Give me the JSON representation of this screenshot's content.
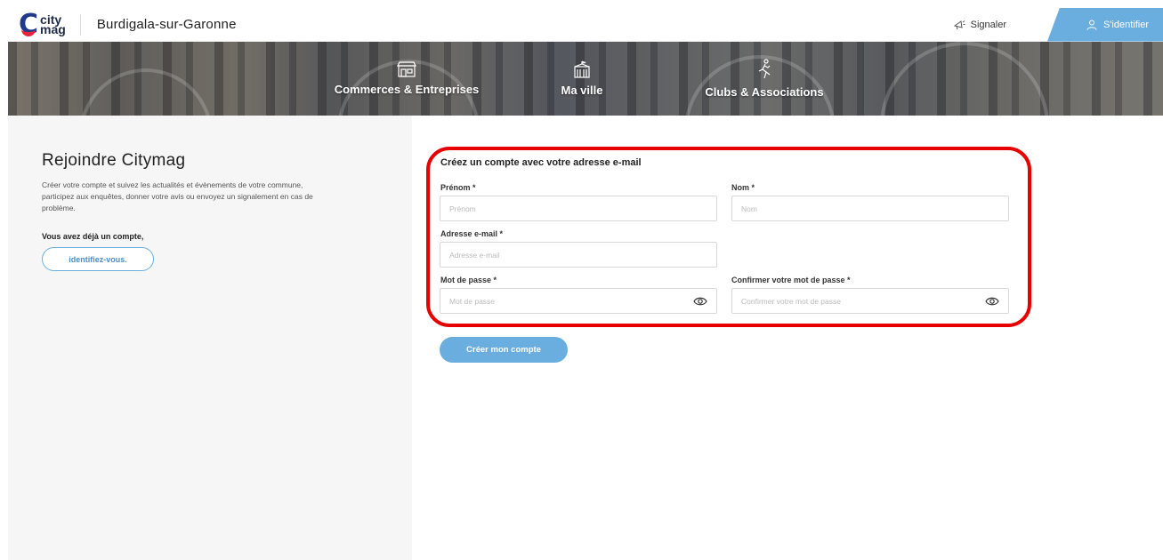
{
  "header": {
    "logo_top": "city",
    "logo_bottom": "mag",
    "city_name": "Burdigala-sur-Garonne",
    "report_label": "Signaler",
    "login_label": "S'identifier"
  },
  "nav": {
    "items": [
      {
        "label": "Commerces & Entreprises",
        "icon": "shop-icon"
      },
      {
        "label": "Ma ville",
        "icon": "town-hall-icon"
      },
      {
        "label": "Clubs & Associations",
        "icon": "runner-icon"
      }
    ]
  },
  "sidebar": {
    "title": "Rejoindre Citymag",
    "description": "Créer votre compte et suivez les actualités et évènements de votre commune, participez aux enquêtes, donner votre avis ou envoyez un signalement en cas de problème.",
    "already_label": "Vous avez déjà un compte,",
    "login_link": "identifiez-vous."
  },
  "form": {
    "title": "Créez un compte avec votre adresse e-mail",
    "firstname": {
      "label": "Prénom *",
      "placeholder": "Prénom"
    },
    "lastname": {
      "label": "Nom *",
      "placeholder": "Nom"
    },
    "email": {
      "label": "Adresse e-mail *",
      "placeholder": "Adresse e-mail"
    },
    "password": {
      "label": "Mot de passe *",
      "placeholder": "Mot de passe"
    },
    "confirm": {
      "label": "Confirmer votre mot de passe *",
      "placeholder": "Confirmer votre mot de passe"
    },
    "submit_label": "Créer mon compte"
  },
  "colors": {
    "accent": "#6aaee0",
    "highlight": "#e60000",
    "brand_blue": "#1f3a8a",
    "brand_red": "#e5243b"
  }
}
